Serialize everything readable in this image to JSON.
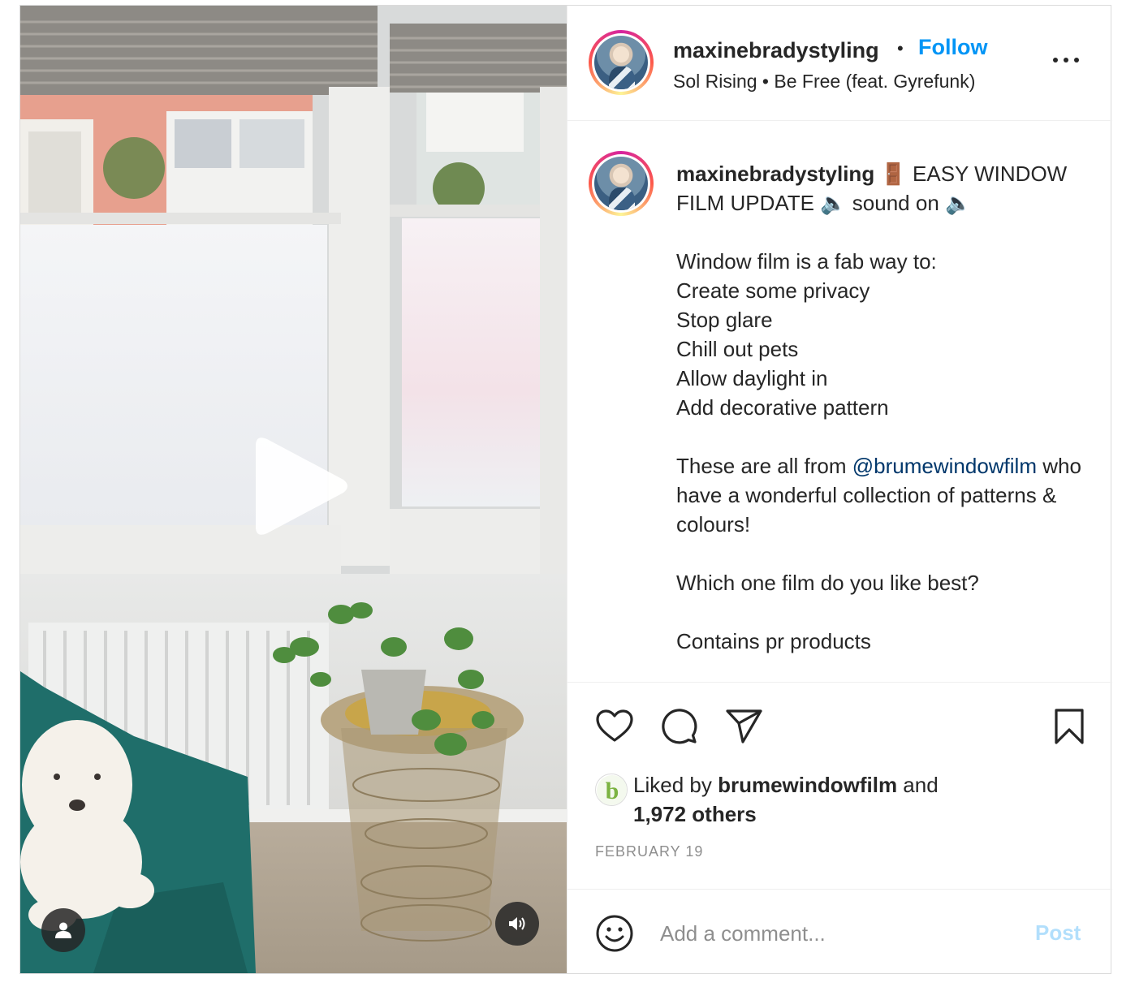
{
  "post": {
    "author": "maxinebradystyling",
    "separator": "•",
    "follow_label": "Follow",
    "audio": "Sol Rising • Be Free (feat. Gyrefunk)",
    "more_icon": "more-options-icon"
  },
  "caption": {
    "username": "maxinebradystyling",
    "line1": " 🚪 EASY WINDOW FILM UPDATE 🔈 sound on 🔈",
    "list_intro": "Window film is a fab way to:",
    "list": [
      "Create some privacy",
      "Stop glare",
      "Chill out pets",
      "Allow daylight in",
      "Add decorative pattern"
    ],
    "source_prefix": "These are all from ",
    "mention": "@brumewindowfilm",
    "source_suffix": " who have a wonderful collection of patterns & colours!",
    "question": "Which one film do you like best?",
    "disclaimer": "Contains pr products"
  },
  "actions": {
    "icons": [
      "heart-icon",
      "comment-icon",
      "share-icon",
      "bookmark-icon"
    ]
  },
  "likes": {
    "prefix": "Liked by ",
    "liker": "brumewindowfilm",
    "middle": " and ",
    "others": "1,972 others",
    "liker_avatar_letter": "b"
  },
  "date": "FEBRUARY 19",
  "comment": {
    "placeholder": "Add a comment...",
    "post_label": "Post",
    "post_color": "#b2dffc"
  },
  "colors": {
    "follow": "#0095f6",
    "mention": "#00376b",
    "muted": "#8e8e8e"
  }
}
